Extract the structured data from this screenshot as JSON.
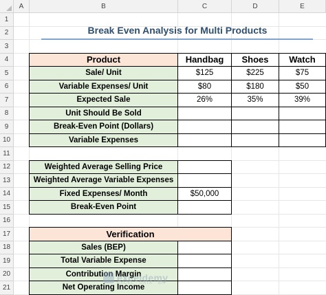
{
  "sheet": {
    "columns": [
      "A",
      "B",
      "C",
      "D",
      "E"
    ],
    "rows": [
      "1",
      "2",
      "3",
      "4",
      "5",
      "6",
      "7",
      "8",
      "9",
      "10",
      "11",
      "12",
      "13",
      "14",
      "15",
      "16",
      "17",
      "18",
      "19",
      "20",
      "21"
    ]
  },
  "title": "Break Even Analysis for Multi Products",
  "table1": {
    "header": [
      "Product",
      "Handbag",
      "Shoes",
      "Watch"
    ],
    "rows": [
      {
        "label": "Sale/ Unit",
        "values": [
          "$125",
          "$225",
          "$75"
        ]
      },
      {
        "label": "Variable Expenses/ Unit",
        "values": [
          "$80",
          "$180",
          "$50"
        ]
      },
      {
        "label": "Expected Sale",
        "values": [
          "26%",
          "35%",
          "39%"
        ]
      },
      {
        "label": "Unit Should Be Sold",
        "values": [
          "",
          "",
          ""
        ]
      },
      {
        "label": "Break-Even Point (Dollars)",
        "values": [
          "",
          "",
          ""
        ]
      },
      {
        "label": "Variable Expenses",
        "values": [
          "",
          "",
          ""
        ]
      }
    ]
  },
  "table2": {
    "rows": [
      {
        "label": "Weighted Average Selling Price",
        "value": ""
      },
      {
        "label": "Weighted Average Variable Expenses",
        "value": ""
      },
      {
        "label": "Fixed Expenses/ Month",
        "value": "$50,000"
      },
      {
        "label": "Break-Even Point",
        "value": ""
      }
    ]
  },
  "table3": {
    "header": "Verification",
    "rows": [
      {
        "label": "Sales (BEP)",
        "value": ""
      },
      {
        "label": "Total Variable Expense",
        "value": ""
      },
      {
        "label": "Contribution Margin",
        "value": ""
      },
      {
        "label": "Net Operating Income",
        "value": ""
      }
    ]
  },
  "watermark": {
    "name": "exceldemy",
    "sub": "EXCEL · DATA · BI"
  },
  "colors": {
    "green": "#e2efda",
    "peach": "#fce4d6",
    "title": "#2f4f6f"
  }
}
